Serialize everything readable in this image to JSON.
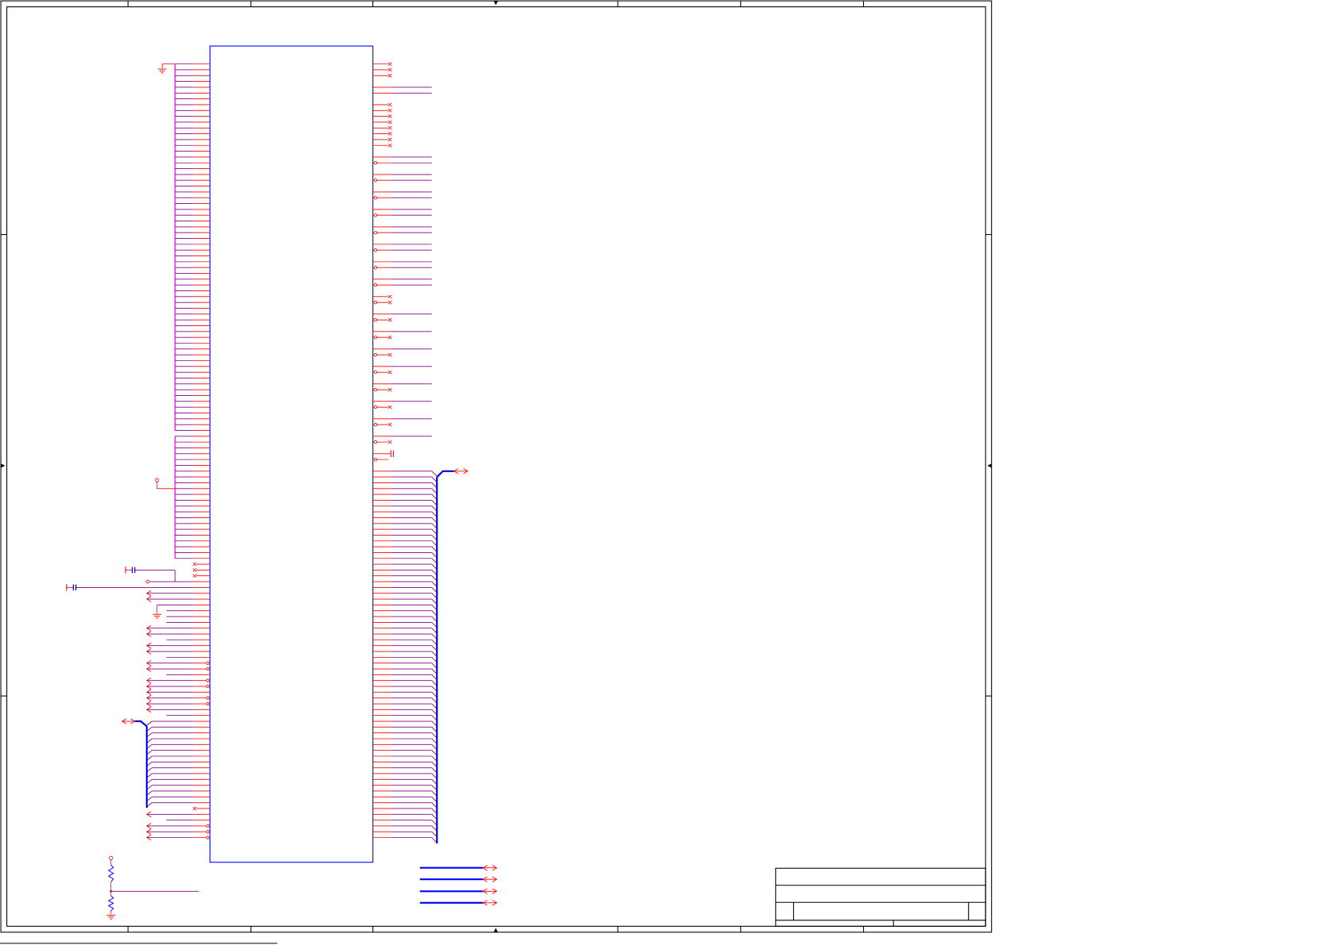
{
  "colors": {
    "background": "#ffffff",
    "frame": "#000000",
    "body": "#0000ff",
    "pin": "#ff0000",
    "wire": "#800080",
    "net_spine": "#cc00cc",
    "bus": "#0000ff",
    "footer": "#333333"
  },
  "symbols": {
    "ground": "ground-symbol-icon",
    "capacitor": "capacitor-symbol-icon",
    "resistor": "resistor-symbol-icon",
    "no_connect": "no-connect-icon",
    "off_page": "off-page-connector-icon",
    "bidirectional_port": "bidirectional-port-icon",
    "power_port": "power-port-icon"
  }
}
